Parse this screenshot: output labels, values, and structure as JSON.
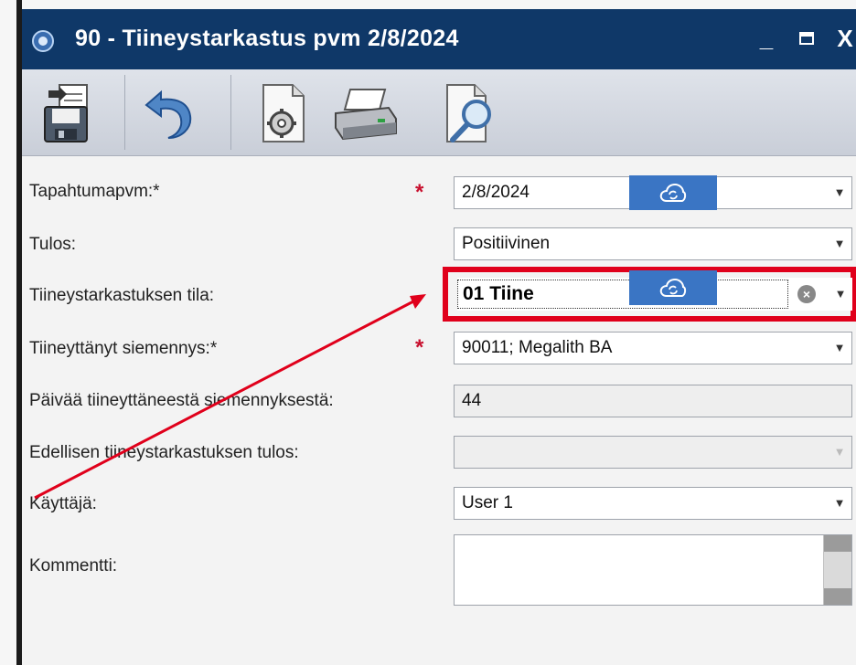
{
  "window": {
    "title": "90 - Tiineystarkastus pvm 2/8/2024",
    "min_label": "_",
    "max_label": "▪",
    "close_label": "X"
  },
  "toolbar": {
    "icons": [
      "save-icon",
      "undo-icon",
      "settings-document-icon",
      "print-icon",
      "preview-search-icon"
    ]
  },
  "form": {
    "required_mark": "*",
    "rows": [
      {
        "label": "Tapahtumapvm:*",
        "value": "2/8/2024",
        "required": true
      },
      {
        "label": "Tulos:",
        "value": "Positiivinen"
      },
      {
        "label": "Tiineystarkastuksen tila:",
        "value": "01 Tiine"
      },
      {
        "label": "Tiineyttänyt siemennys:*",
        "value": "90011; Megalith BA",
        "required": true
      },
      {
        "label": "Päivää tiineyttäneestä siemennyksestä:",
        "value": "44"
      },
      {
        "label": "Edellisen tiineystarkastuksen tulos:",
        "value": ""
      },
      {
        "label": "Käyttäjä:",
        "value": "User 1"
      },
      {
        "label": "Kommentti:",
        "value": ""
      }
    ]
  },
  "colors": {
    "titlebar": "#0f3868",
    "highlight": "#e0001b",
    "cloud_button": "#3a75c4",
    "required": "#c8102e"
  }
}
